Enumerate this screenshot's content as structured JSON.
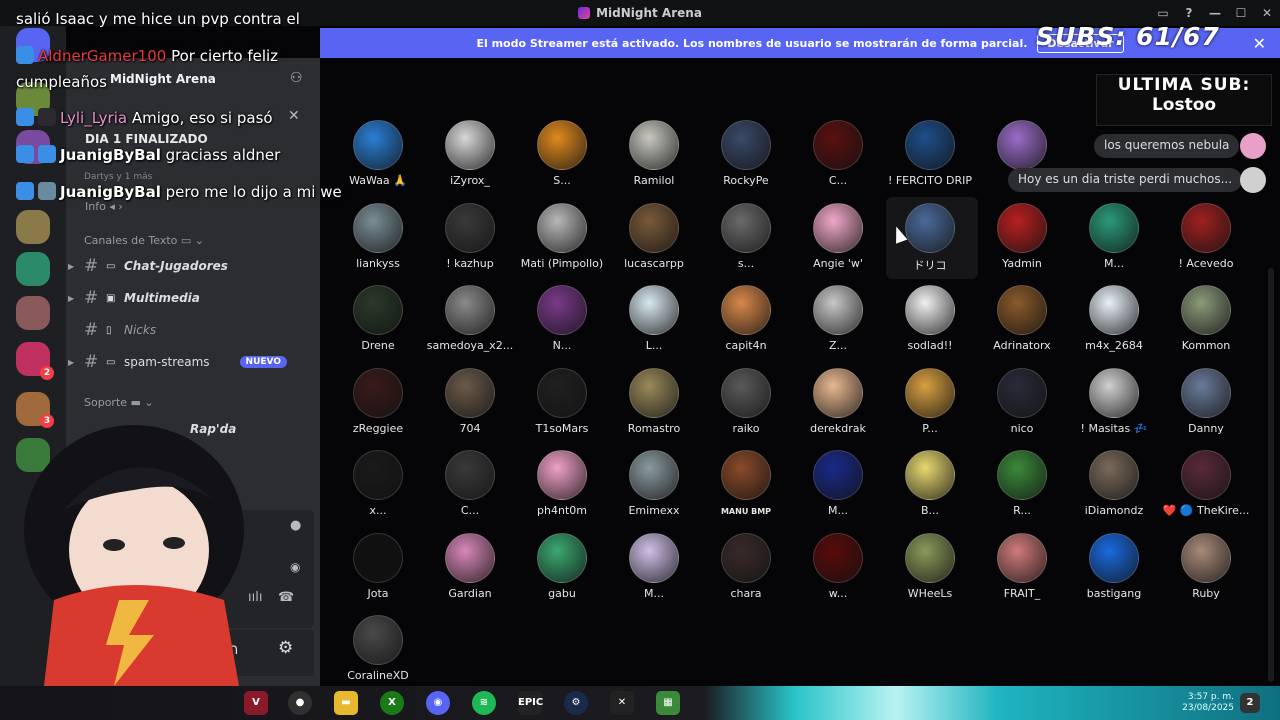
{
  "window": {
    "title": "MidNight Arena"
  },
  "banner": {
    "text": "El modo Streamer está activado. Los nombres de usuario se mostrarán de forma parcial.",
    "button": "Desactivar"
  },
  "sidebar": {
    "server_name": "MidNight Arena",
    "subtitle": "Dartys y 1 más",
    "event_text": "DIA 1 FINALIZADO",
    "info_label": "Info",
    "text_category": "Canales de Texto",
    "support_category": "Soporte",
    "channels": [
      {
        "name": "Chat-Jugadores"
      },
      {
        "name": "Multimedia"
      },
      {
        "name": "Nicks"
      },
      {
        "name": "spam-streams",
        "badge": "NUEVO"
      }
    ],
    "voice_user": "Rap'da",
    "server_badges": [
      "2",
      "3"
    ]
  },
  "chat_overlay": [
    {
      "user": "",
      "message": "salió Isaac y me hice un pvp contra el"
    },
    {
      "user": "AldnerGamer100",
      "message": " Por cierto feliz"
    },
    {
      "user": "",
      "message": "cumpleaños"
    },
    {
      "user": "Lyli_Lyria",
      "message": " Amigo, eso si pasó"
    },
    {
      "user": "JuanigByBal",
      "message": " graciass aldner"
    },
    {
      "user": "JuanigByBal",
      "message": " pero me lo dijo a mi we"
    }
  ],
  "overlay": {
    "subs": "SUBS: 61/67",
    "ultima_label": "ULTIMA SUB:",
    "ultima_name": "Lostoo"
  },
  "activities": [
    {
      "text": "los queremos nebula",
      "color": "#e8a0c8"
    },
    {
      "text": "Hoy es un dia triste perdi muchos...",
      "color": "#d0d0d0"
    }
  ],
  "members": [
    [
      "WaWaa 🙏",
      "#2b7fd6"
    ],
    [
      "iZyrox_",
      "#d8d8d8"
    ],
    [
      "S...",
      "#e08a1e"
    ],
    [
      "Ramilol",
      "#c8c8c0"
    ],
    [
      "RockyPe",
      "#3a4a6a"
    ],
    [
      "C...",
      "#5a1010"
    ],
    [
      "! FERCITO DRIP",
      "#1e4f8a"
    ],
    [
      "!...",
      "#9a6cc8"
    ],
    [
      "",
      "#555"
    ],
    [
      "",
      "#555"
    ],
    [
      "liankyss",
      "#7a8e96"
    ],
    [
      "! kazhup",
      "#3a3a3a"
    ],
    [
      "Mati (Pimpollo)",
      "#b8b8b8"
    ],
    [
      "lucascarpp",
      "#7a5a3a"
    ],
    [
      "s...",
      "#6a6a6a"
    ],
    [
      "Angie 'w'",
      "#f0a8c8"
    ],
    [
      "ドリコ",
      "#4a6a9a"
    ],
    [
      "Yadmin",
      "#b82020"
    ],
    [
      "M...",
      "#2a9a7a"
    ],
    [
      "! Acevedo",
      "#a02020"
    ],
    [
      "Drene",
      "#2a3a2a"
    ],
    [
      "samedoya_x2...",
      "#8a8a8a"
    ],
    [
      "N...",
      "#7a3a8a"
    ],
    [
      "L...",
      "#d8e8f0"
    ],
    [
      "capit4n",
      "#d8884a"
    ],
    [
      "Z...",
      "#c8c8c8"
    ],
    [
      "sodlad!!",
      "#f0f0f0"
    ],
    [
      "Adrinatorx",
      "#8a5a2a"
    ],
    [
      "m4x_2684",
      "#e8f0f8"
    ],
    [
      "Kommon",
      "#8a9a7a"
    ],
    [
      "zReggiee",
      "#3a1a1a"
    ],
    [
      "704",
      "#6a5a4a"
    ],
    [
      "T1soMars",
      "#202020"
    ],
    [
      "Romastro",
      "#9a8a5a"
    ],
    [
      "raiko",
      "#5a5a5a"
    ],
    [
      "derekdrak",
      "#e8b890"
    ],
    [
      "P...",
      "#d8a040"
    ],
    [
      "nico",
      "#2a2a3a"
    ],
    [
      "! Masitas 💤",
      "#d0d0d0"
    ],
    [
      "Danny",
      "#6a7a9a"
    ],
    [
      "x...",
      "#1a1a1a"
    ],
    [
      "C...",
      "#3a3a3a"
    ],
    [
      "ph4nt0m",
      "#f0a0c8"
    ],
    [
      "Emimexx",
      "#8a9aa0"
    ],
    [
      "MANU BMP",
      "#8a4a2a"
    ],
    [
      "M...",
      "#1a2a8a"
    ],
    [
      "B...",
      "#e8d870"
    ],
    [
      "R...",
      "#3a8a3a"
    ],
    [
      "iDiamondz",
      "#7a6a5a"
    ],
    [
      "❤️ 🔵 TheKire...",
      "#5a2a3a"
    ],
    [
      "Jota",
      "#101010"
    ],
    [
      "Gardian",
      "#d888b8"
    ],
    [
      "gabu",
      "#3aa870"
    ],
    [
      "M...",
      "#d0c0e8"
    ],
    [
      "chara",
      "#3a2a2a"
    ],
    [
      "w...",
      "#5a0a0a"
    ],
    [
      "WHeeLs",
      "#8a9a5a"
    ],
    [
      "FRAIT_",
      "#d07a7a"
    ],
    [
      "bastigang",
      "#1a6ae0"
    ],
    [
      "Ruby",
      "#a88a7a"
    ],
    [
      "CoralineXD",
      "#4a4a4a"
    ]
  ],
  "taskbar": {
    "time": "3:57 p. m.",
    "date": "23/08/2025",
    "notifications": "2",
    "apps": [
      "valorant",
      "obs",
      "files",
      "xbox",
      "discord",
      "spotify",
      "epic",
      "steam",
      "capcut",
      "minecraft"
    ]
  }
}
